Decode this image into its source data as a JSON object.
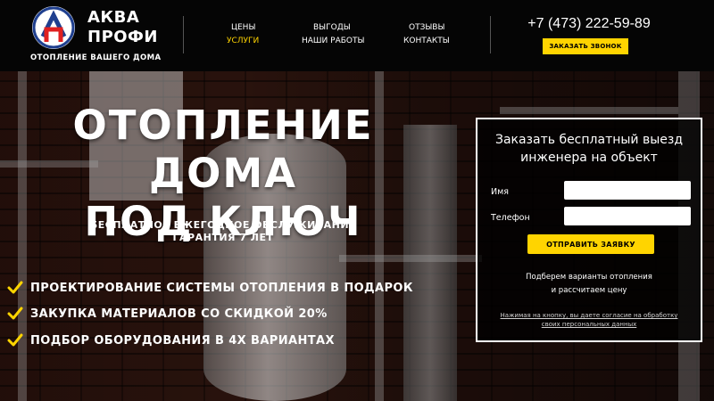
{
  "header": {
    "brand_line1": "АКВА",
    "brand_line2": "ПРОФИ",
    "tagline": "ОТОПЛЕНИЕ ВАШЕГО ДОМА",
    "logo_icon": "aqua-profi-logo",
    "nav": [
      {
        "label": "ЦЕНЫ",
        "active": false
      },
      {
        "label": "УСЛУГИ",
        "active": true
      },
      {
        "label": "ВЫГОДЫ",
        "active": false
      },
      {
        "label": "НАШИ РАБОТЫ",
        "active": false
      },
      {
        "label": "ОТЗЫВЫ",
        "active": false
      },
      {
        "label": "КОНТАКТЫ",
        "active": false
      }
    ],
    "phone": "+7 (473) 222-59-89",
    "callback_label": "ЗАКАЗАТЬ ЗВОНОК"
  },
  "hero": {
    "title_line1": "ОТОПЛЕНИЕ ДОМА",
    "title_line2": "ПОД КЛЮЧ",
    "sub_line1": "БЕСПЛАТНОЕ ЕЖЕГОДНОЕ ОБСЛУЖИВАНИЕ",
    "sub_line2": "ГАРАНТИЯ 7 ЛЕТ",
    "features": [
      "ПРОЕКТИРОВАНИЕ СИСТЕМЫ ОТОПЛЕНИЯ В ПОДАРОК",
      "ЗАКУПКА МАТЕРИАЛОВ СО СКИДКОЙ 20%",
      "ПОДБОР ОБОРУДОВАНИЯ В 4Х ВАРИАНТАХ"
    ],
    "feature_icon": "check-icon"
  },
  "form": {
    "title_line1": "Заказать бесплатный выезд",
    "title_line2": "инженера на объект",
    "name_label": "Имя",
    "name_value": "",
    "phone_label": "Телефон",
    "phone_value": "",
    "submit_label": "ОТПРАВИТЬ ЗАЯВКУ",
    "note_line1": "Подберем варианты отопления",
    "note_line2": "и рассчитаем цену",
    "consent_line1": "Нажимая на кнопку, вы даете согласие на обработку",
    "consent_line2": "своих персональных данных"
  },
  "colors": {
    "accent": "#ffd400",
    "header_bg": "#050505",
    "logo_red": "#e02020",
    "logo_blue": "#1f3f8f"
  }
}
